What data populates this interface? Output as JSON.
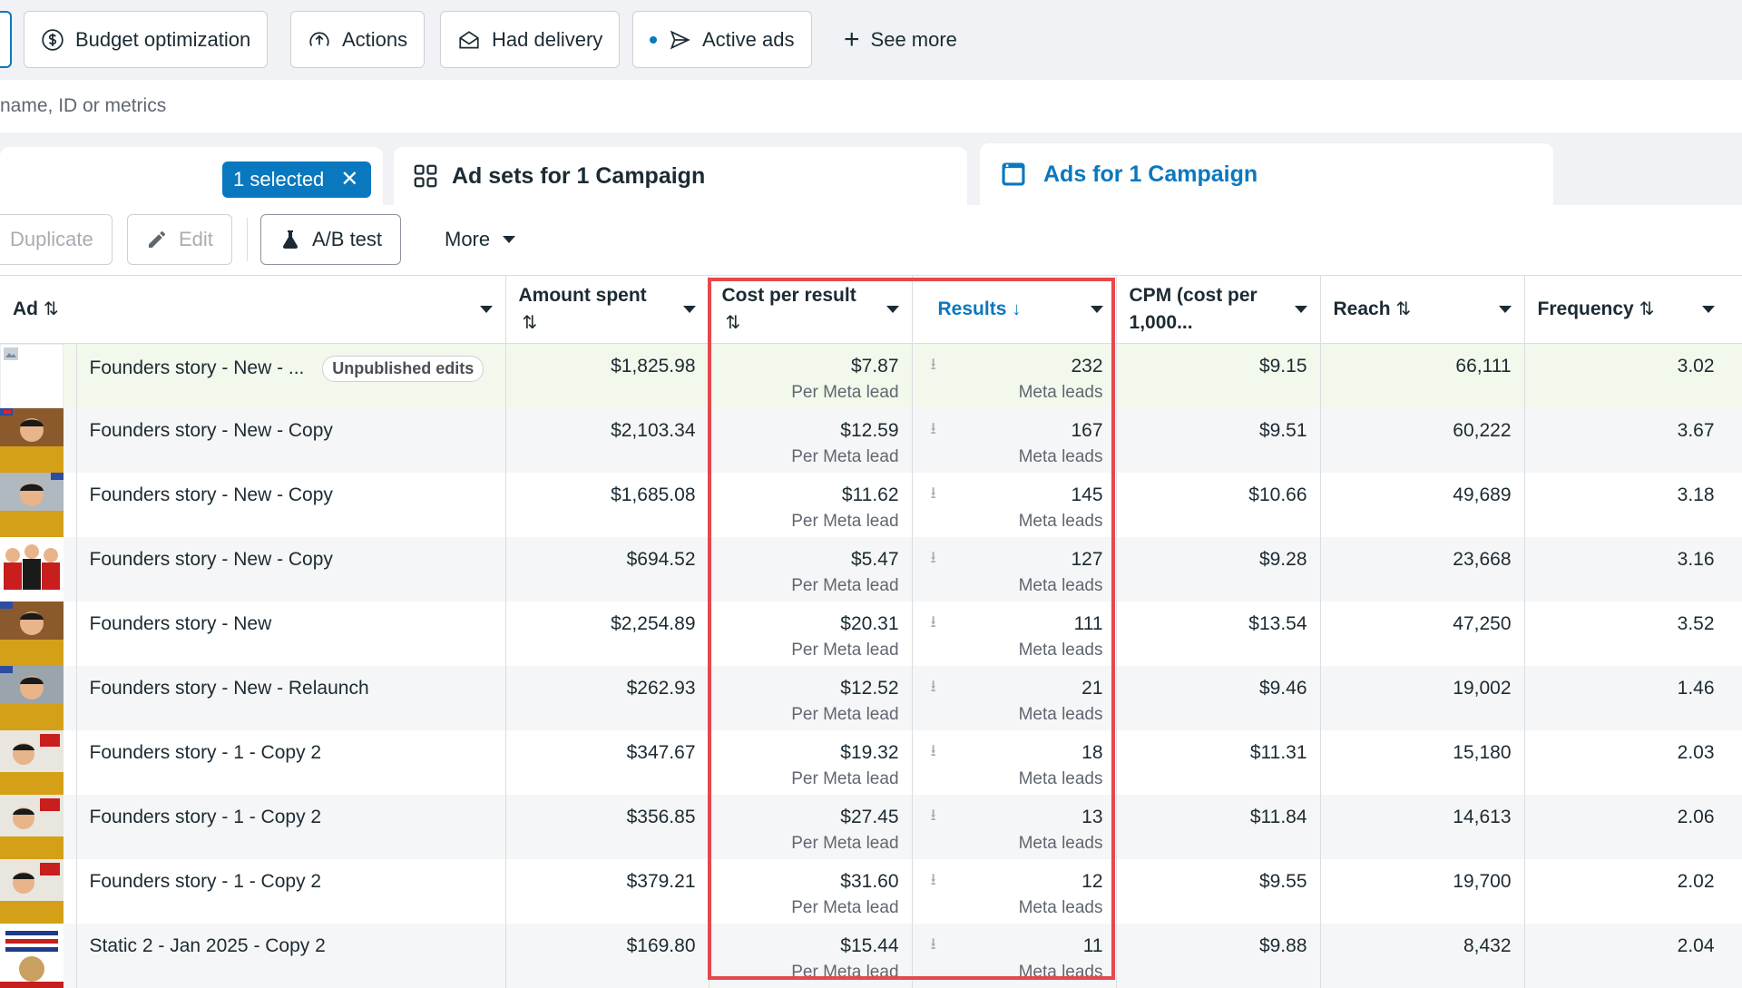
{
  "filters": [
    {
      "label": "Budget optimization",
      "icon": "dollar-circle-icon"
    },
    {
      "label": "Actions",
      "icon": "arrow-up-circle-icon"
    },
    {
      "label": "Had delivery",
      "icon": "envelope-open-icon"
    },
    {
      "label": "Active ads",
      "icon": "send-icon"
    }
  ],
  "see_more": "See more",
  "search": {
    "placeholder": "name, ID or metrics"
  },
  "tabs": {
    "selected_chip": "1 selected",
    "adsets": "Ad sets for 1 Campaign",
    "ads": "Ads for 1 Campaign"
  },
  "toolbar": {
    "duplicate": "Duplicate",
    "edit": "Edit",
    "ab_test": "A/B test",
    "more": "More"
  },
  "table": {
    "columns": {
      "ad": "Ad",
      "amount_spent": "Amount spent",
      "cost_per_result": "Cost per result",
      "results": "Results",
      "cpm": "CPM (cost per 1,000...",
      "reach": "Reach",
      "frequency": "Frequency"
    },
    "sort_icon": "⇅",
    "sorted_desc_icon": "↓",
    "cost_sub": "Per Meta lead",
    "results_sub": "Meta leads",
    "rows": [
      {
        "name": "Founders story - New - ...",
        "badge": "Unpublished edits",
        "spent": "$1,825.98",
        "cpr": "$7.87",
        "results": "232",
        "cpm": "$9.15",
        "reach": "66,111",
        "freq": "3.02"
      },
      {
        "name": "Founders story - New - Copy",
        "spent": "$2,103.34",
        "cpr": "$12.59",
        "results": "167",
        "cpm": "$9.51",
        "reach": "60,222",
        "freq": "3.67"
      },
      {
        "name": "Founders story - New - Copy",
        "spent": "$1,685.08",
        "cpr": "$11.62",
        "results": "145",
        "cpm": "$10.66",
        "reach": "49,689",
        "freq": "3.18"
      },
      {
        "name": "Founders story - New - Copy",
        "spent": "$694.52",
        "cpr": "$5.47",
        "results": "127",
        "cpm": "$9.28",
        "reach": "23,668",
        "freq": "3.16"
      },
      {
        "name": "Founders story - New",
        "spent": "$2,254.89",
        "cpr": "$20.31",
        "results": "111",
        "cpm": "$13.54",
        "reach": "47,250",
        "freq": "3.52"
      },
      {
        "name": "Founders story - New - Relaunch",
        "spent": "$262.93",
        "cpr": "$12.52",
        "results": "21",
        "cpm": "$9.46",
        "reach": "19,002",
        "freq": "1.46"
      },
      {
        "name": "Founders story - 1 - Copy 2",
        "spent": "$347.67",
        "cpr": "$19.32",
        "results": "18",
        "cpm": "$11.31",
        "reach": "15,180",
        "freq": "2.03"
      },
      {
        "name": "Founders story - 1 - Copy 2",
        "spent": "$356.85",
        "cpr": "$27.45",
        "results": "13",
        "cpm": "$11.84",
        "reach": "14,613",
        "freq": "2.06"
      },
      {
        "name": "Founders story - 1 - Copy 2",
        "spent": "$379.21",
        "cpr": "$31.60",
        "results": "12",
        "cpm": "$9.55",
        "reach": "19,700",
        "freq": "2.02"
      },
      {
        "name": "Static 2 - Jan 2025 - Copy 2",
        "spent": "$169.80",
        "cpr": "$15.44",
        "results": "11",
        "cpm": "$9.88",
        "reach": "8,432",
        "freq": "2.04"
      }
    ]
  },
  "colors": {
    "accent": "#0a78be",
    "highlight_border": "#e5484d",
    "row_highlight": "#f3f8ec"
  }
}
